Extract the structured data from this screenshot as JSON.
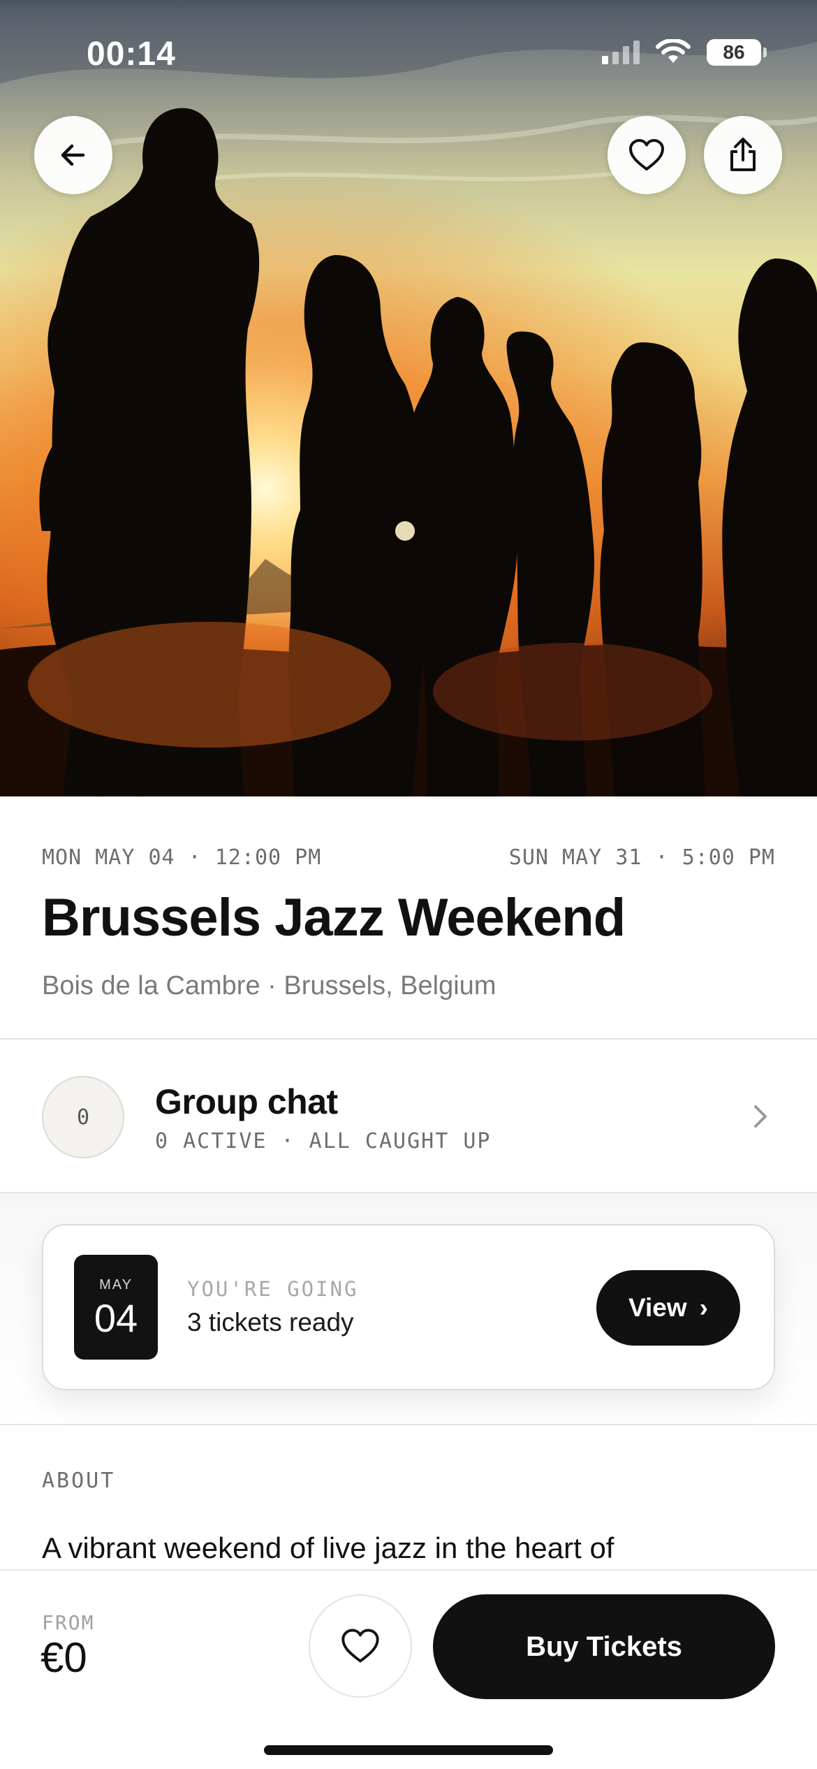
{
  "status_bar": {
    "time": "00:14",
    "battery": "86"
  },
  "hero": {
    "back_icon": "arrow-left-icon",
    "favorite_icon": "heart-icon",
    "share_icon": "share-icon"
  },
  "event": {
    "start": "MON MAY 04 · 12:00 PM",
    "end": "SUN MAY 31 · 5:00 PM",
    "title": "Brussels Jazz Weekend",
    "venue": "Bois de la Cambre · Brussels, Belgium"
  },
  "group_chat": {
    "count": "0",
    "title": "Group chat",
    "subtitle": "0 ACTIVE · ALL CAUGHT UP",
    "chevron_icon": "chevron-right-icon"
  },
  "going_card": {
    "month": "MAY",
    "day": "04",
    "label": "YOU'RE GOING",
    "text": "3 tickets ready",
    "button_label": "View",
    "button_icon": "›"
  },
  "about": {
    "label": "ABOUT",
    "text": "A vibrant weekend of live jazz in the heart of"
  },
  "bottom_bar": {
    "from_label": "FROM",
    "price": "€0",
    "favorite_icon": "heart-icon",
    "buy_label": "Buy Tickets"
  },
  "colors": {
    "primary": "#111111",
    "muted_text": "#6d6d6d",
    "divider": "#e4e4e4"
  }
}
